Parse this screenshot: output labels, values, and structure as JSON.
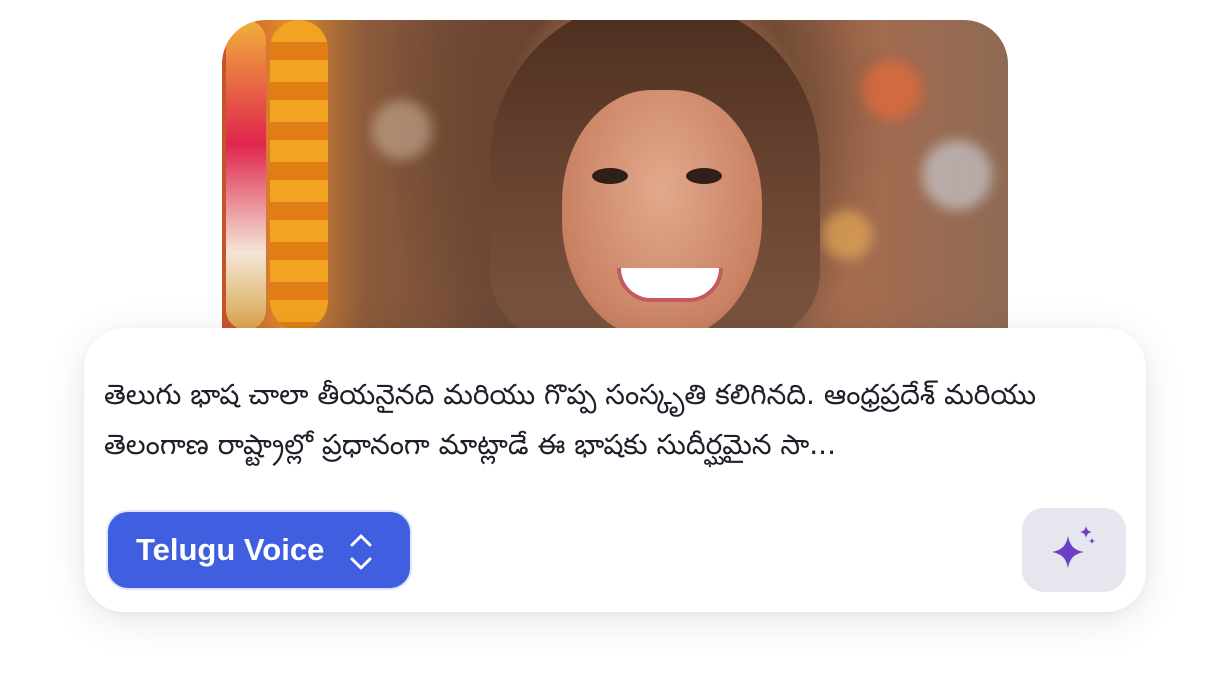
{
  "photo": {
    "icon": "portrait-photo"
  },
  "card": {
    "text": "తెలుగు భాష చాలా తీయనైనది మరియు గొప్ప సంస్కృతి కలిగినది. ఆంధ్రప్రదేశ్ మరియు తెలంగాణ రాష్ట్రాల్లో ప్రధానంగా మాట్లాడే ఈ భాషకు సుదీర్ఘమైన సా...",
    "voice_label": "Telugu Voice",
    "voice_icon": "chevron-up-down-icon",
    "magic_icon": "sparkle-icon"
  },
  "colors": {
    "accent": "#3f5fe0",
    "sparkle": "#6a3fc6",
    "secondary_button": "#e6e6ee"
  }
}
